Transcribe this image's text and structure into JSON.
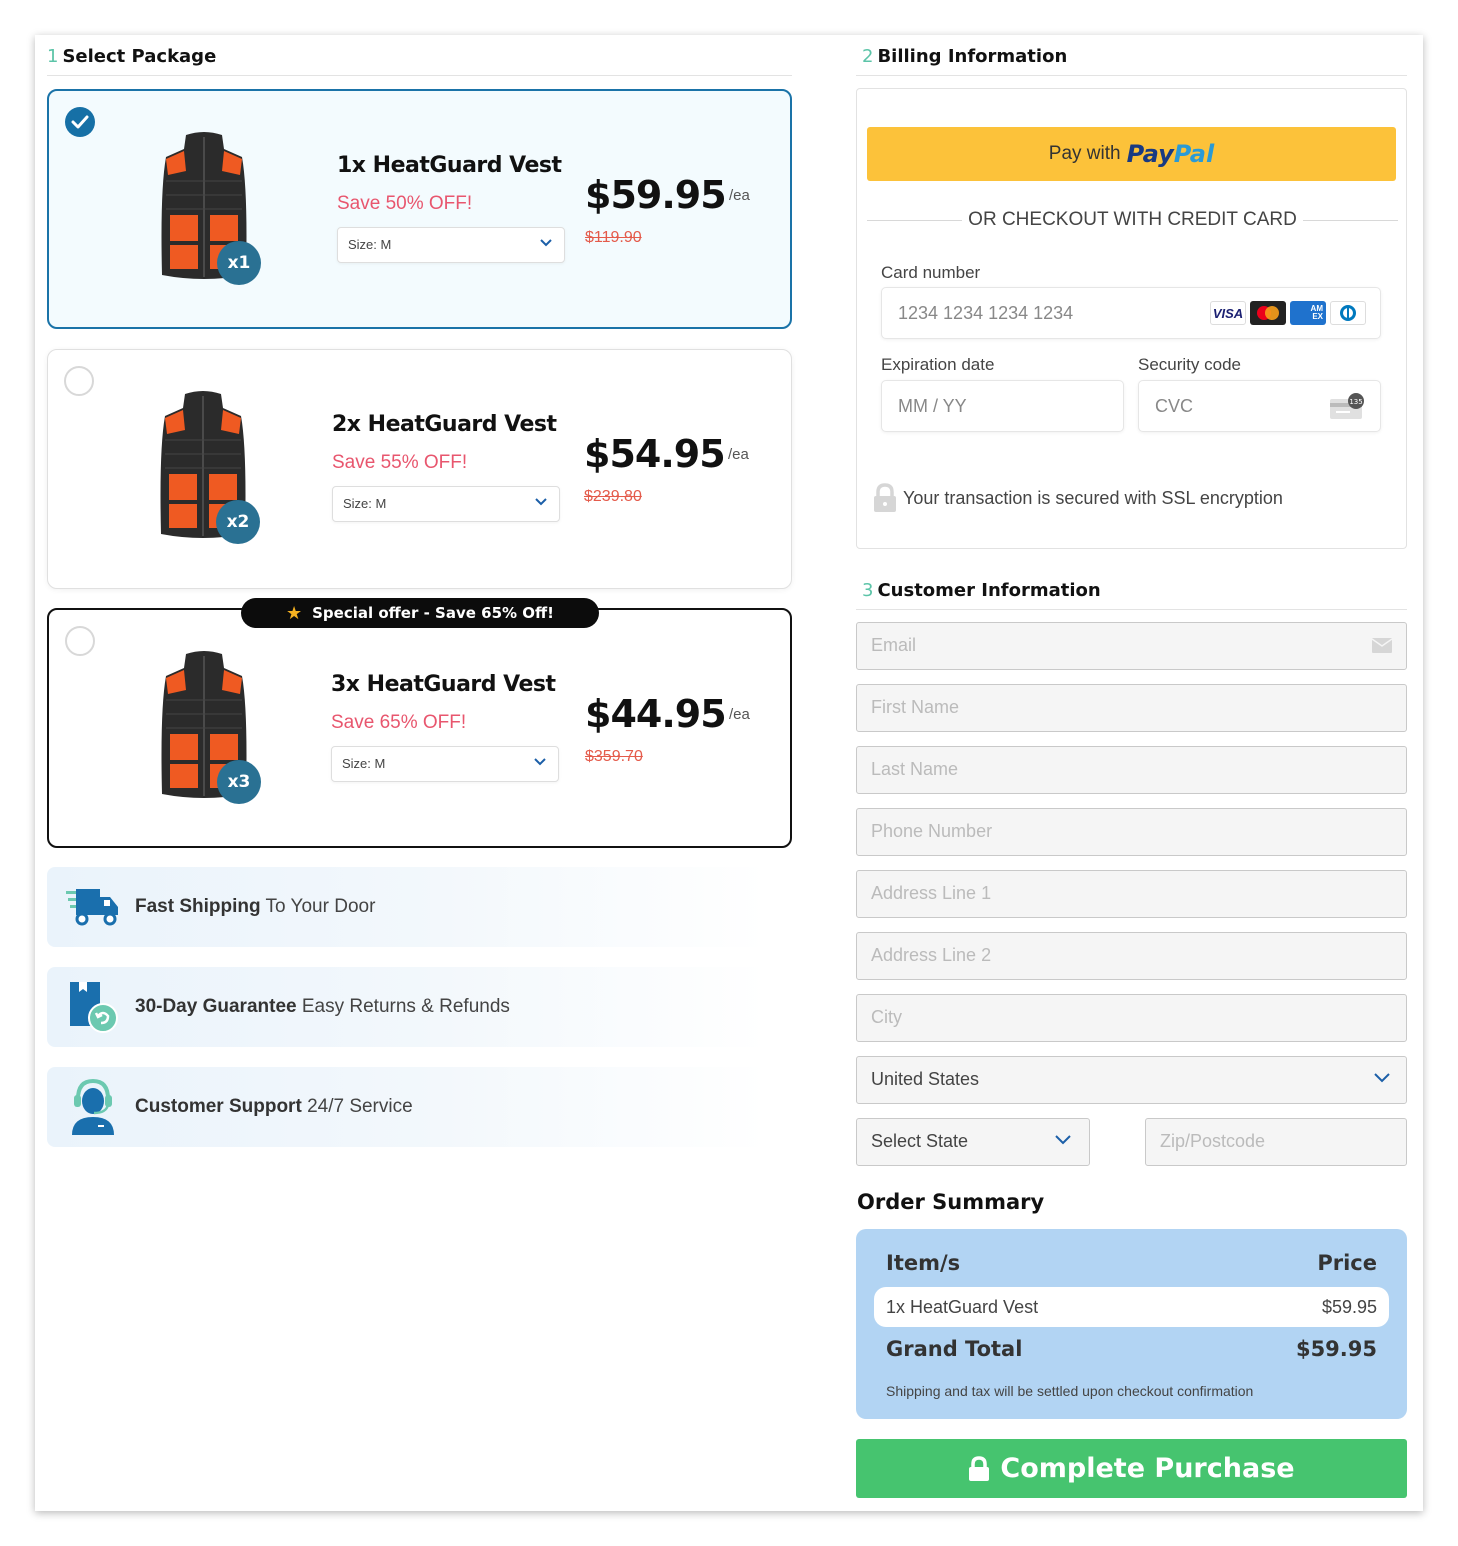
{
  "sections": {
    "package": {
      "num": "1",
      "title": "Select Package"
    },
    "billing": {
      "num": "2",
      "title": "Billing Information"
    },
    "customer": {
      "num": "3",
      "title": "Customer Information"
    }
  },
  "packages": [
    {
      "title": "1x HeatGuard Vest",
      "save": "Save 50% OFF!",
      "size": "Size: M",
      "price": "$59.95",
      "unit": "/ea",
      "old_price": "$119.90",
      "qty_badge": "x1",
      "selected": true
    },
    {
      "title": "2x HeatGuard Vest",
      "save": "Save 55% OFF!",
      "size": "Size: M",
      "price": "$54.95",
      "unit": "/ea",
      "old_price": "$239.80",
      "qty_badge": "x2",
      "selected": false
    },
    {
      "title": "3x HeatGuard Vest",
      "save": "Save 65% OFF!",
      "size": "Size: M",
      "price": "$44.95",
      "unit": "/ea",
      "old_price": "$359.70",
      "qty_badge": "x3",
      "selected": false,
      "banner": "Special offer - Save 65% Off!"
    }
  ],
  "features": [
    {
      "bold": "Fast Shipping",
      "rest": "To Your Door",
      "icon": "truck-icon"
    },
    {
      "bold": "30-Day Guarantee",
      "rest": "Easy Returns & Refunds",
      "icon": "return-box-icon"
    },
    {
      "bold": "Customer Support",
      "rest": "24/7 Service",
      "icon": "support-agent-icon"
    }
  ],
  "billing": {
    "paypal_prefix": "Pay with",
    "paypal_brand_1": "Pay",
    "paypal_brand_2": "Pal",
    "or_text": "OR CHECKOUT WITH CREDIT CARD",
    "card_number_label": "Card number",
    "card_number_placeholder": "1234 1234 1234 1234",
    "card_brands": [
      "VISA",
      "Mastercard",
      "AMEX",
      "Diners"
    ],
    "expiry_label": "Expiration date",
    "expiry_placeholder": "MM / YY",
    "cvc_label": "Security code",
    "cvc_placeholder": "CVC",
    "cvc_hint": "135",
    "ssl_text": "Your transaction is secured with SSL encryption"
  },
  "customer": {
    "email": "Email",
    "first_name": "First Name",
    "last_name": "Last Name",
    "phone": "Phone Number",
    "address1": "Address Line 1",
    "address2": "Address Line 2",
    "city": "City",
    "country": "United States",
    "state": "Select State",
    "zip": "Zip/Postcode"
  },
  "order_summary": {
    "title": "Order Summary",
    "col_items": "Item/s",
    "col_price": "Price",
    "items": [
      {
        "name": "1x HeatGuard Vest",
        "price": "$59.95"
      }
    ],
    "grand_total_label": "Grand Total",
    "grand_total": "$59.95",
    "note": "Shipping and tax will be settled upon checkout confirmation"
  },
  "purchase_button": "Complete Purchase",
  "colors": {
    "accent_blue": "#1670a6",
    "save_red": "#e8566e",
    "paypal_yellow": "#fcc23a",
    "purchase_green": "#46c46f",
    "summary_blue": "#b2d4f3",
    "step_teal": "#5cc4a8"
  }
}
